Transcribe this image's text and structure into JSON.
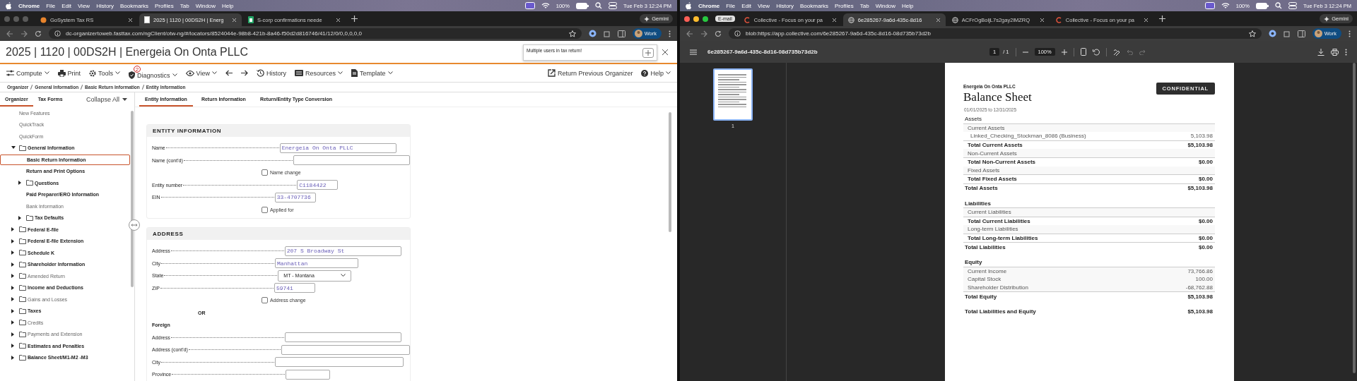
{
  "windows": [
    {
      "menu_bar": {
        "app": "Chrome",
        "items": [
          "File",
          "Edit",
          "View",
          "History",
          "Bookmarks",
          "Profiles",
          "Tab",
          "Window",
          "Help"
        ],
        "battery": "100%",
        "clock": "Tue Feb 3 12:24 PM"
      },
      "browser": {
        "tabs": [
          {
            "title": "GoSystem Tax RS",
            "selected": false,
            "kind": "circle"
          },
          {
            "title": "2025 | 1120 | 00DS2H | Energ",
            "selected": true,
            "kind": "page"
          },
          {
            "title": "S-corp confirmations neede",
            "selected": false,
            "kind": "sheet"
          }
        ],
        "gemini": "Gemini",
        "url": "dc-organizertoweb.fasttax.com/ngClient/otw-ng/#/locators/8524044e-98b8-421b-8a46-f50d2d816746/41/12/0/0,0,0,0,0",
        "profile": "Work"
      },
      "organizer": {
        "title": "2025 | 1120 | 00DS2H | Energeia On Onta PLLC",
        "notice": "Multiple users in tax return!",
        "toolbar_left": [
          {
            "kind": "sliders",
            "label": "Compute",
            "caret": true
          },
          {
            "kind": "printer",
            "label": "Print",
            "caret": false
          },
          {
            "kind": "gear",
            "label": "Tools",
            "caret": true
          },
          {
            "kind": "shield",
            "label": "Diagnostics",
            "caret": true,
            "badge": "2"
          },
          {
            "kind": "eye",
            "label": "View",
            "caret": true
          },
          {
            "kind": "back",
            "caret": false
          },
          {
            "kind": "forward",
            "caret": false
          },
          {
            "kind": "history",
            "label": "History",
            "caret": false
          },
          {
            "kind": "card",
            "label": "Resources",
            "caret": true
          },
          {
            "kind": "document",
            "label": "Template",
            "caret": true
          }
        ],
        "toolbar_right": [
          {
            "kind": "export",
            "label": "Return Previous Organizer",
            "caret": false
          },
          {
            "kind": "help",
            "label": "Help",
            "caret": true
          }
        ],
        "breadcrumb": [
          "Organizer",
          "General Information",
          "Basic Return Information",
          "Entity Information"
        ],
        "side_tabs": [
          {
            "label": "Organizer",
            "selected": true
          },
          {
            "label": "Tax Forms",
            "selected": false
          }
        ],
        "collapse_all": "Collapse All",
        "tree": [
          {
            "label": "New Features",
            "folder": false,
            "bold": false,
            "selected": false
          },
          {
            "label": "QuickTrack",
            "folder": false,
            "bold": false,
            "selected": false
          },
          {
            "label": "QuickForm",
            "folder": false,
            "bold": false,
            "selected": false
          },
          {
            "label": "General Information",
            "folder": true,
            "bold": true,
            "selected": false,
            "expanded": true,
            "children": [
              {
                "label": "Basic Return Information",
                "folder": false,
                "bold": true,
                "selected": true
              },
              {
                "label": "Return and Print Options",
                "folder": false,
                "bold": true,
                "selected": false
              },
              {
                "label": "Questions",
                "folder": true,
                "bold": true,
                "selected": false,
                "expanded": false
              },
              {
                "label": "Paid Preparer/ERO Information",
                "folder": false,
                "bold": true,
                "selected": false
              },
              {
                "label": "Bank Information",
                "folder": false,
                "bold": false,
                "selected": false
              },
              {
                "label": "Tax Defaults",
                "folder": true,
                "bold": true,
                "selected": false,
                "expanded": false
              }
            ]
          },
          {
            "label": "Federal E-file",
            "folder": true,
            "bold": true,
            "selected": false,
            "expanded": false
          },
          {
            "label": "Federal E-file Extension",
            "folder": true,
            "bold": true,
            "selected": false,
            "expanded": false
          },
          {
            "label": "Schedule K",
            "folder": true,
            "bold": true,
            "selected": false,
            "expanded": false
          },
          {
            "label": "Shareholder Information",
            "folder": true,
            "bold": true,
            "selected": false,
            "expanded": false
          },
          {
            "label": "Amended Return",
            "folder": true,
            "bold": false,
            "selected": false,
            "expanded": false
          },
          {
            "label": "Income and Deductions",
            "folder": true,
            "bold": true,
            "selected": false,
            "expanded": false
          },
          {
            "label": "Gains and Losses",
            "folder": true,
            "bold": false,
            "selected": false,
            "expanded": false
          },
          {
            "label": "Taxes",
            "folder": true,
            "bold": true,
            "selected": false,
            "expanded": false
          },
          {
            "label": "Credits",
            "folder": true,
            "bold": false,
            "selected": false,
            "expanded": false
          },
          {
            "label": "Payments and Extension",
            "folder": true,
            "bold": false,
            "selected": false,
            "expanded": false
          },
          {
            "label": "Estimates and Penalties",
            "folder": true,
            "bold": true,
            "selected": false,
            "expanded": false
          },
          {
            "label": "Balance Sheet/M1-M2 -M3",
            "folder": true,
            "bold": true,
            "selected": false,
            "expanded": false
          }
        ],
        "form_tabs": [
          {
            "label": "Entity Information",
            "selected": true
          },
          {
            "label": "Return Information",
            "selected": false
          },
          {
            "label": "Return/Entity Type Conversion",
            "selected": false
          }
        ],
        "sections": [
          {
            "title": "ENTITY INFORMATION",
            "rows": [
              {
                "kind": "long",
                "label": "Name",
                "value": "Energeia On Onta PLLC"
              },
              {
                "kind": "long",
                "label": "Name (cont'd)"
              },
              {
                "kind": "checkbox",
                "label": "Name change",
                "checked": false
              },
              {
                "kind": "short",
                "label": "Entity number",
                "value": "C1184422"
              },
              {
                "kind": "short",
                "label": "EIN",
                "value": "33-4707736"
              },
              {
                "kind": "checkbox",
                "label": "Applied for",
                "checked": false
              }
            ]
          },
          {
            "title": "ADDRESS",
            "rows": [
              {
                "kind": "long",
                "label": "Address",
                "value": "207 S Broadway St"
              },
              {
                "kind": "medium",
                "label": "City",
                "value": "Manhattan"
              },
              {
                "kind": "select",
                "label": "State",
                "value": "MT - Montana"
              },
              {
                "kind": "short",
                "label": "ZIP",
                "value": "59741"
              },
              {
                "kind": "checkbox",
                "label": "Address change",
                "checked": false
              },
              {
                "kind": "or",
                "label": "OR"
              },
              {
                "kind": "subhead",
                "label": "Foreign"
              },
              {
                "kind": "long",
                "label": "Address"
              },
              {
                "kind": "wide",
                "label": "Address (cont'd)"
              },
              {
                "kind": "wide",
                "label": "City"
              },
              {
                "kind": "province",
                "label": "Province"
              }
            ]
          }
        ]
      }
    },
    {
      "menu_bar": {
        "app": "Chrome",
        "items": [
          "File",
          "Edit",
          "View",
          "History",
          "Bookmarks",
          "Profiles",
          "Tab",
          "Window",
          "Help"
        ],
        "battery": "100%",
        "clock": "Tue Feb 3 12:24 PM"
      },
      "browser": {
        "tab_group": "E-mail",
        "tabs": [
          {
            "title": "Collective - Focus on your pa",
            "selected": false,
            "kind": "letter-c"
          },
          {
            "title": "6e285267-9a6d-435c-8d16",
            "selected": true,
            "kind": "globe"
          },
          {
            "title": "ACFrOgBoljL7s2gay2lMZRQ",
            "selected": false,
            "kind": "globe"
          },
          {
            "title": "Collective - Focus on your pa",
            "selected": false,
            "kind": "letter-c"
          }
        ],
        "gemini": "Gemini",
        "url": "blob:https://app.collective.com/6e285267-9a6d-435c-8d16-08d735b73d2b",
        "profile": "Work"
      },
      "pdf_viewer": {
        "file": "6e285267-9a6d-435c-8d16-08d735b73d2b",
        "page": "1",
        "page_total": "/ 1",
        "zoom": "100%",
        "thumbnail_label": "1",
        "document": {
          "company": "Energeia On Onta PLLC",
          "badge": "CONFIDENTIAL",
          "title": "Balance Sheet",
          "period": "01/01/2025 to 12/31/2025",
          "rows": [
            {
              "kind": "section",
              "label": "Assets"
            },
            {
              "kind": "group",
              "label": "Current Assets"
            },
            {
              "kind": "item",
              "label": "Linked_Checking_Stockman_8086 (Business)",
              "amount": "5,103.98"
            },
            {
              "kind": "subtotal",
              "label": "Total Current Assets",
              "amount": "$5,103.98"
            },
            {
              "kind": "group",
              "label": "Non-Current Assets"
            },
            {
              "kind": "subtotal",
              "label": "Total Non-Current Assets",
              "amount": "$0.00"
            },
            {
              "kind": "group",
              "label": "Fixed Assets"
            },
            {
              "kind": "subtotal",
              "label": "Total Fixed Assets",
              "amount": "$0.00"
            },
            {
              "kind": "total",
              "label": "Total Assets",
              "amount": "$5,103.98"
            },
            {
              "kind": "section",
              "label": "Liabilities"
            },
            {
              "kind": "group",
              "label": "Current Liabilities"
            },
            {
              "kind": "subtotal",
              "label": "Total Current Liabilities",
              "amount": "$0.00"
            },
            {
              "kind": "group",
              "label": "Long-term Liabilities"
            },
            {
              "kind": "subtotal",
              "label": "Total Long-term Liabilities",
              "amount": "$0.00"
            },
            {
              "kind": "total",
              "label": "Total Liabilities",
              "amount": "$0.00"
            },
            {
              "kind": "section",
              "label": "Equity"
            },
            {
              "kind": "group",
              "label": "Current Income",
              "amount": "73,766.86"
            },
            {
              "kind": "group",
              "label": "Capital Stock",
              "amount": "100.00"
            },
            {
              "kind": "group",
              "label": "Shareholder Distribution",
              "amount": "-68,762.88"
            },
            {
              "kind": "total",
              "label": "Total Equity",
              "amount": "$5,103.98"
            },
            {
              "kind": "grand",
              "label": "Total Liabilities and Equity",
              "amount": "$5,103.98"
            }
          ]
        }
      }
    }
  ]
}
